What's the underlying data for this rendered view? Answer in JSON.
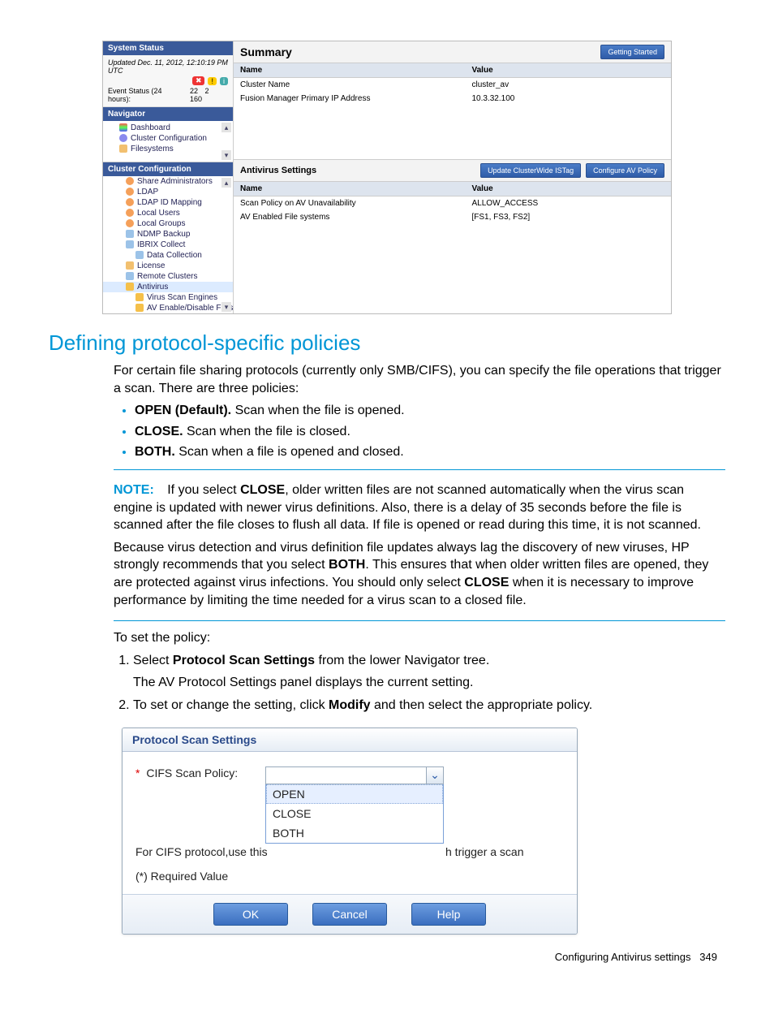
{
  "app": {
    "status": {
      "title": "System Status",
      "updated": "Updated Dec. 11, 2012, 12:10:19 PM UTC",
      "event_label": "Event Status (24 hours):",
      "counts": {
        "err": "22",
        "warn": "2",
        "info": "160"
      }
    },
    "navigator": {
      "title": "Navigator",
      "items": [
        "Dashboard",
        "Cluster Configuration",
        "Filesystems"
      ]
    },
    "cluster": {
      "title": "Cluster Configuration",
      "items": [
        "Share Administrators",
        "LDAP",
        "LDAP ID Mapping",
        "Local Users",
        "Local Groups",
        "NDMP Backup",
        "IBRIX Collect",
        "Data Collection",
        "License",
        "Remote Clusters",
        "Antivirus",
        "Virus Scan Engines",
        "AV Enable/Disable Filesystems"
      ]
    },
    "summary": {
      "title": "Summary",
      "btn": "Getting Started",
      "cols": {
        "name": "Name",
        "value": "Value"
      },
      "rows": [
        {
          "name": "Cluster Name",
          "value": "cluster_av"
        },
        {
          "name": "Fusion Manager Primary IP Address",
          "value": "10.3.32.100"
        }
      ]
    },
    "av": {
      "title": "Antivirus Settings",
      "btn1": "Update ClusterWide ISTag",
      "btn2": "Configure AV Policy",
      "cols": {
        "name": "Name",
        "value": "Value"
      },
      "rows": [
        {
          "name": "Scan Policy on AV Unavailability",
          "value": "ALLOW_ACCESS"
        },
        {
          "name": "AV Enabled File systems",
          "value": "[FS1, FS3, FS2]"
        }
      ]
    }
  },
  "doc": {
    "h2": "Defining protocol-specific policies",
    "intro": "For certain file sharing protocols (currently only SMB/CIFS), you can specify the file operations that trigger a scan. There are three policies:",
    "bullets": [
      {
        "b": "OPEN (Default).",
        "t": " Scan when the file is opened."
      },
      {
        "b": "CLOSE.",
        "t": " Scan when the file is closed."
      },
      {
        "b": "BOTH.",
        "t": " Scan when a file is opened and closed."
      }
    ],
    "note_label": "NOTE:",
    "note_p1a": "If you select ",
    "note_p1b": "CLOSE",
    "note_p1c": ", older written files are not scanned automatically when the virus scan engine is updated with newer virus definitions. Also, there is a delay of 35 seconds before the file is scanned after the file closes to flush all data. If file is opened or read during this time, it is not scanned.",
    "note_p2a": "Because virus detection and virus definition file updates always lag the discovery of new viruses, HP strongly recommends that you select ",
    "note_p2b": "BOTH",
    "note_p2c": ". This ensures that when older written files are opened, they are protected against virus infections. You should only select ",
    "note_p2d": "CLOSE",
    "note_p2e": " when it is necessary to improve performance by limiting the time needed for a virus scan to a closed file.",
    "toset": "To set the policy:",
    "step1a": "Select ",
    "step1b": "Protocol Scan Settings",
    "step1c": " from the lower Navigator tree.",
    "step1_sub": "The AV Protocol Settings panel displays the current setting.",
    "step2a": "To set or change the setting, click ",
    "step2b": "Modify",
    "step2c": " and then select the appropriate policy."
  },
  "dlg": {
    "title": "Protocol Scan Settings",
    "field_label": "CIFS Scan Policy:",
    "options": [
      "OPEN",
      "CLOSE",
      "BOTH"
    ],
    "desc_left": "For CIFS protocol,use this",
    "desc_right": "h trigger a scan",
    "req": "(*) Required Value",
    "ok": "OK",
    "cancel": "Cancel",
    "help": "Help"
  },
  "footer": {
    "text": "Configuring Antivirus settings",
    "page": "349"
  }
}
